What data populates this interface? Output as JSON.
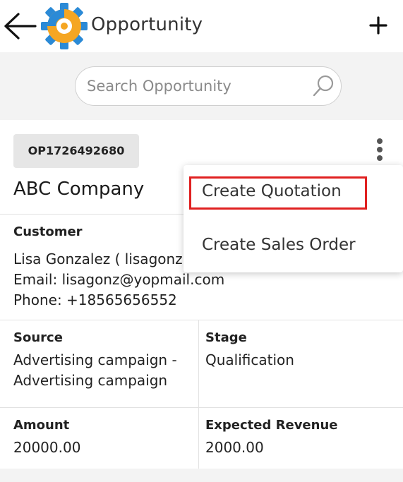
{
  "header": {
    "title": "Opportunity",
    "back_icon": "arrow-left-icon",
    "add_icon": "plus-icon",
    "logo_icon": "gear-logo-icon",
    "logo_colors": {
      "gear": "#f5a623",
      "accent": "#2b8ad6"
    }
  },
  "search": {
    "placeholder": "Search Opportunity",
    "icon": "search-icon"
  },
  "opportunity": {
    "id": "OP1726492680",
    "company": "ABC Company",
    "customer_label": "Customer",
    "customer_name": "Lisa Gonzalez ( lisagonz",
    "customer_email": "Email: lisagonz@yopmail.com",
    "customer_phone": "Phone: +18565656552",
    "source_label": "Source",
    "source_value_line1": "Advertising campaign -",
    "source_value_line2": "Advertising campaign",
    "stage_label": "Stage",
    "stage_value": "Qualification",
    "amount_label": "Amount",
    "amount_value": "20000.00",
    "expected_revenue_label": "Expected Revenue",
    "expected_revenue_value": "2000.00"
  },
  "menu": {
    "items": [
      {
        "label": "Create Quotation",
        "highlighted": true
      },
      {
        "label": "Create Sales Order",
        "highlighted": false
      }
    ],
    "highlight_color": "#e02020"
  }
}
